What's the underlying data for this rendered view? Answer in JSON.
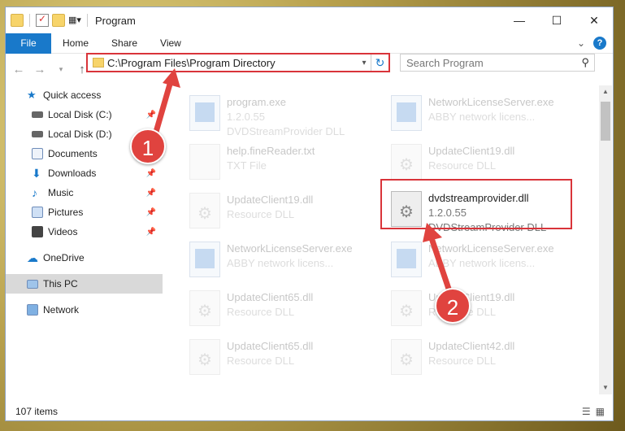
{
  "window": {
    "title": "Program"
  },
  "ribbon": {
    "tabs": [
      "File",
      "Home",
      "Share",
      "View"
    ],
    "help": "?"
  },
  "address": {
    "path": "C:\\Program Files\\Program Directory",
    "search_placeholder": "Search Program"
  },
  "sidebar": {
    "items": [
      {
        "label": "Quick access"
      },
      {
        "label": "Local Disk (C:)"
      },
      {
        "label": "Local Disk (D:)"
      },
      {
        "label": "Documents"
      },
      {
        "label": "Downloads"
      },
      {
        "label": "Music"
      },
      {
        "label": "Pictures"
      },
      {
        "label": "Videos"
      },
      {
        "label": "OneDrive"
      },
      {
        "label": "This PC"
      },
      {
        "label": "Network"
      }
    ]
  },
  "files": [
    {
      "name": "program.exe",
      "line2": "1.2.0.55",
      "line3": "DVDStreamProvider DLL"
    },
    {
      "name": "NetworkLicenseServer.exe",
      "line2": "ABBY network licens...",
      "line3": ""
    },
    {
      "name": "help.fineReader.txt",
      "line2": "TXT File",
      "line3": ""
    },
    {
      "name": "UpdateClient19.dll",
      "line2": "Resource DLL",
      "line3": ""
    },
    {
      "name": "UpdateClient19.dll",
      "line2": "Resource DLL",
      "line3": ""
    },
    {
      "name": "dvdstreamprovider.dll",
      "line2": "1.2.0.55",
      "line3": "DVDStreamProvider DLL"
    },
    {
      "name": "NetworkLicenseServer.exe",
      "line2": "ABBY network licens...",
      "line3": ""
    },
    {
      "name": "NetworkLicenseServer.exe",
      "line2": "ABBY network licens...",
      "line3": ""
    },
    {
      "name": "UpdateClient65.dll",
      "line2": "Resource DLL",
      "line3": ""
    },
    {
      "name": "UpdateClient19.dll",
      "line2": "Resource DLL",
      "line3": ""
    },
    {
      "name": "UpdateClient65.dll",
      "line2": "Resource DLL",
      "line3": ""
    },
    {
      "name": "UpdateClient42.dll",
      "line2": "Resource DLL",
      "line3": ""
    }
  ],
  "status": {
    "count": "107 items"
  },
  "annotations": {
    "badge1": "1",
    "badge2": "2"
  },
  "colors": {
    "accent": "#1979ca",
    "highlight": "#d9343a"
  }
}
